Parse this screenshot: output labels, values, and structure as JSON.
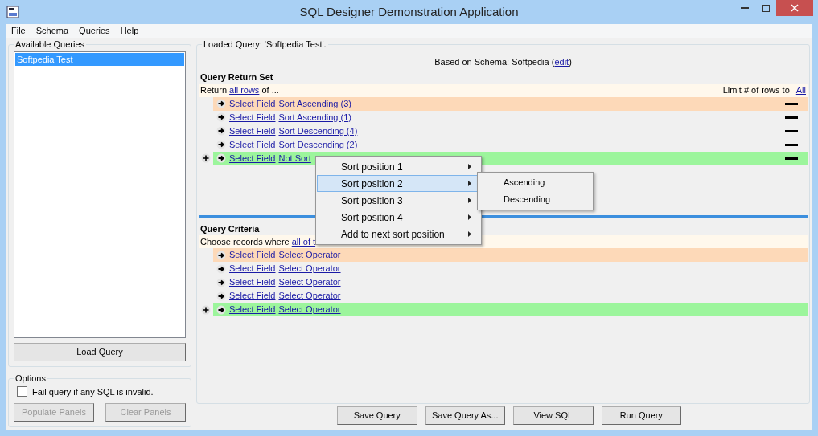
{
  "window": {
    "title": "SQL Designer Demonstration Application"
  },
  "menu": [
    "File",
    "Schema",
    "Queries",
    "Help"
  ],
  "available_queries": {
    "title": "Available Queries",
    "items": [
      {
        "label": "Softpedia Test",
        "selected": true
      }
    ],
    "load_button": "Load Query"
  },
  "options": {
    "title": "Options",
    "checkbox": {
      "label": "Fail query if any SQL is invalid.",
      "checked": false
    },
    "buttons": [
      {
        "label": "Populate Panels",
        "disabled": true
      },
      {
        "label": "Clear Panels",
        "disabled": true
      }
    ]
  },
  "query": {
    "title": "Loaded Query: 'Softpedia Test'.",
    "schema_prefix": "Based on Schema: Softpedia (",
    "schema_link": "edit",
    "schema_suffix": ")"
  },
  "return_set": {
    "title": "Query Return Set",
    "intro_prefix": "Return ",
    "intro_link": "all rows",
    "intro_suffix": " of ...",
    "limit_label": "Limit # of rows to",
    "limit_link": "All",
    "rows": [
      {
        "kind": "current",
        "field": "Select Field",
        "sort": "Sort Ascending (3)"
      },
      {
        "kind": "plain",
        "field": "Select Field",
        "sort": "Sort Ascending (1)"
      },
      {
        "kind": "plain",
        "field": "Select Field",
        "sort": "Sort Descending (4)"
      },
      {
        "kind": "plain",
        "field": "Select Field",
        "sort": "Sort Descending (2)"
      },
      {
        "kind": "new",
        "field": "Select Field",
        "sort": "Not Sort"
      }
    ]
  },
  "criteria": {
    "title": "Query Criteria",
    "intro_prefix": "Choose records where ",
    "intro_link": "all of t",
    "rows": [
      {
        "kind": "current",
        "field": "Select Field",
        "operator": "Select Operator"
      },
      {
        "kind": "plain",
        "field": "Select Field",
        "operator": "Select Operator"
      },
      {
        "kind": "plain",
        "field": "Select Field",
        "operator": "Select Operator"
      },
      {
        "kind": "plain",
        "field": "Select Field",
        "operator": "Select Operator"
      },
      {
        "kind": "new",
        "field": "Select Field",
        "operator": "Select Operator"
      }
    ]
  },
  "context_menu": {
    "items": [
      {
        "label": "Sort position 1",
        "selected": false
      },
      {
        "label": "Sort position 2",
        "selected": true
      },
      {
        "label": "Sort position 3",
        "selected": false
      },
      {
        "label": "Sort position 4",
        "selected": false
      },
      {
        "label": "Add to next sort position",
        "selected": false
      }
    ],
    "submenu": [
      "Ascending",
      "Descending"
    ]
  },
  "buttons": [
    "Save Query",
    "Save Query As...",
    "View SQL",
    "Run Query"
  ]
}
